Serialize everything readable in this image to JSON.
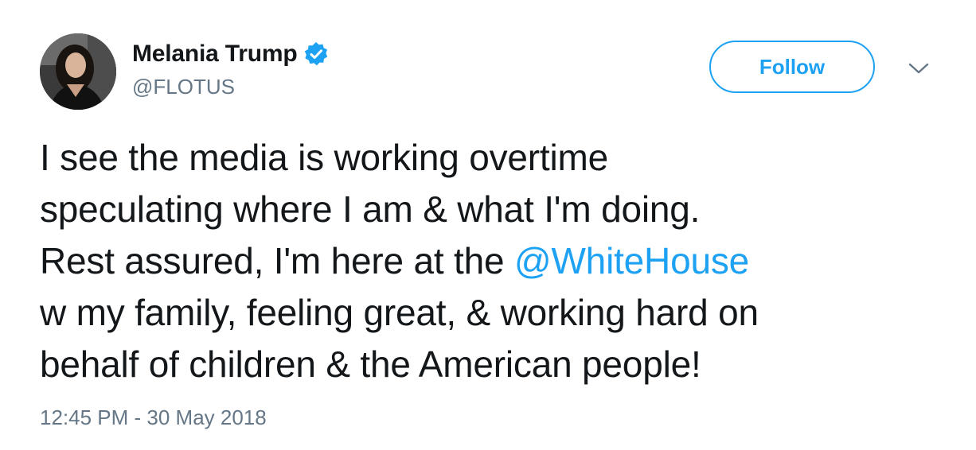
{
  "author": {
    "display_name": "Melania Trump",
    "handle": "@FLOTUS",
    "verified": true
  },
  "follow_button": {
    "label": "Follow"
  },
  "tweet": {
    "lines": {
      "l1": "I see the media is working overtime",
      "l2": "speculating where I am & what I'm doing.",
      "l3_prefix": "Rest assured, I'm here at the ",
      "l3_mention": "@WhiteHouse",
      "l4": "w my family, feeling great, & working hard on",
      "l5": "behalf of children & the American people!"
    },
    "timestamp": "12:45 PM - 30 May 2018"
  },
  "colors": {
    "accent": "#1da1f2",
    "text": "#14171a",
    "muted": "#657786"
  },
  "icons": {
    "verified": "verified-badge-icon",
    "more": "chevron-down-icon"
  }
}
